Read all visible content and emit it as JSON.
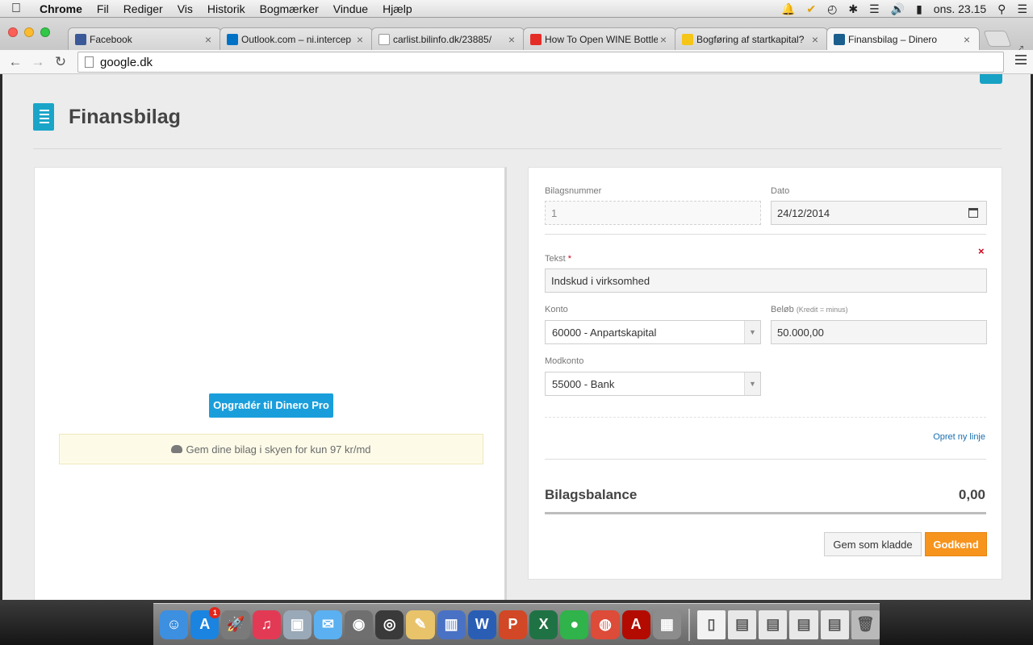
{
  "menubar": {
    "app_name": "Chrome",
    "menus": [
      "Fil",
      "Rediger",
      "Vis",
      "Historik",
      "Bogmærker",
      "Vindue",
      "Hjælp"
    ],
    "clock": "ons. 23.15"
  },
  "tabs": [
    {
      "title": "Facebook",
      "icon": "facebook-icon",
      "color": "#3b5998"
    },
    {
      "title": "Outlook.com – ni.intercep",
      "icon": "outlook-icon",
      "color": "#0072c6"
    },
    {
      "title": "carlist.bilinfo.dk/23885/​",
      "icon": "page-icon",
      "color": "#ffffff"
    },
    {
      "title": "How To Open WINE Bottle",
      "icon": "youtube-icon",
      "color": "#e52d27"
    },
    {
      "title": "Bogføring af startkapital?",
      "icon": "lightbulb-icon",
      "color": "#f5c518"
    },
    {
      "title": "Finansbilag – Dinero",
      "icon": "dinero-icon",
      "color": "#1a5f8e"
    }
  ],
  "toolbar": {
    "url": "google.dk"
  },
  "page": {
    "title": "Finansbilag",
    "accent": "#1aa5c8",
    "left_panel": {
      "upgrade_label": "Opgradér til Dinero Pro",
      "cloud_note": "Gem dine bilag i skyen for kun 97 kr/md"
    },
    "form": {
      "voucher_number": {
        "label": "Bilagsnummer",
        "value": "1"
      },
      "date": {
        "label": "Dato",
        "value": "24/12/2014"
      },
      "text": {
        "label": "Tekst",
        "required_mark": "*",
        "value": "Indskud i virksomhed"
      },
      "account": {
        "label": "Konto",
        "value": "60000 - Anpartskapital"
      },
      "amount": {
        "label": "Beløb",
        "hint": "(Kredit = minus)",
        "value": "50.000,00"
      },
      "counter_account": {
        "label": "Modkonto",
        "value": "55000 - Bank"
      },
      "remove_symbol": "×",
      "add_line_label": "Opret ny linje",
      "balance_label": "Bilagsbalance",
      "balance_value": "0,00",
      "save_draft_label": "Gem som kladde",
      "approve_label": "Godkend",
      "approve_color": "#f7941d"
    }
  },
  "dock": {
    "apps": [
      {
        "name": "finder-icon",
        "glyph": "☺",
        "color": "#3d8fe0"
      },
      {
        "name": "app-store-icon",
        "glyph": "A",
        "color": "#1b84e0",
        "badge": "1"
      },
      {
        "name": "launchpad-icon",
        "glyph": "🚀",
        "color": "#7a7a7a"
      },
      {
        "name": "itunes-icon",
        "glyph": "♫",
        "color": "#e23a55"
      },
      {
        "name": "preview-icon",
        "glyph": "▣",
        "color": "#9aa9b8"
      },
      {
        "name": "messages-icon",
        "glyph": "✉",
        "color": "#5ab0f0"
      },
      {
        "name": "facetime-icon",
        "glyph": "◉",
        "color": "#6f6f6f"
      },
      {
        "name": "photo-booth-icon",
        "glyph": "◎",
        "color": "#3a3a3a"
      },
      {
        "name": "notes-icon",
        "glyph": "✎",
        "color": "#e8c36a"
      },
      {
        "name": "keynote-icon",
        "glyph": "▥",
        "color": "#4a72c4"
      },
      {
        "name": "word-icon",
        "glyph": "W",
        "color": "#2a5eb5"
      },
      {
        "name": "powerpoint-icon",
        "glyph": "P",
        "color": "#d24726"
      },
      {
        "name": "excel-icon",
        "glyph": "X",
        "color": "#1f7244"
      },
      {
        "name": "screen-capture-icon",
        "glyph": "●",
        "color": "#2fb34a"
      },
      {
        "name": "chrome-icon",
        "glyph": "◍",
        "color": "#dd4b39"
      },
      {
        "name": "acrobat-icon",
        "glyph": "A",
        "color": "#b30b00"
      },
      {
        "name": "calculator-icon",
        "glyph": "▦",
        "color": "#8c8c8c"
      },
      {
        "name": "document-icon",
        "glyph": "▯",
        "color": "#f2f2f2"
      },
      {
        "name": "pdf-file-icon",
        "glyph": "▤",
        "color": "#e8e8e8"
      },
      {
        "name": "word-file-icon",
        "glyph": "▤",
        "color": "#e8e8e8"
      },
      {
        "name": "word-file-2-icon",
        "glyph": "▤",
        "color": "#e8e8e8"
      },
      {
        "name": "excel-file-icon",
        "glyph": "▤",
        "color": "#e8e8e8"
      },
      {
        "name": "trash-icon",
        "glyph": "🗑",
        "color": "#b9b9b9"
      }
    ]
  }
}
